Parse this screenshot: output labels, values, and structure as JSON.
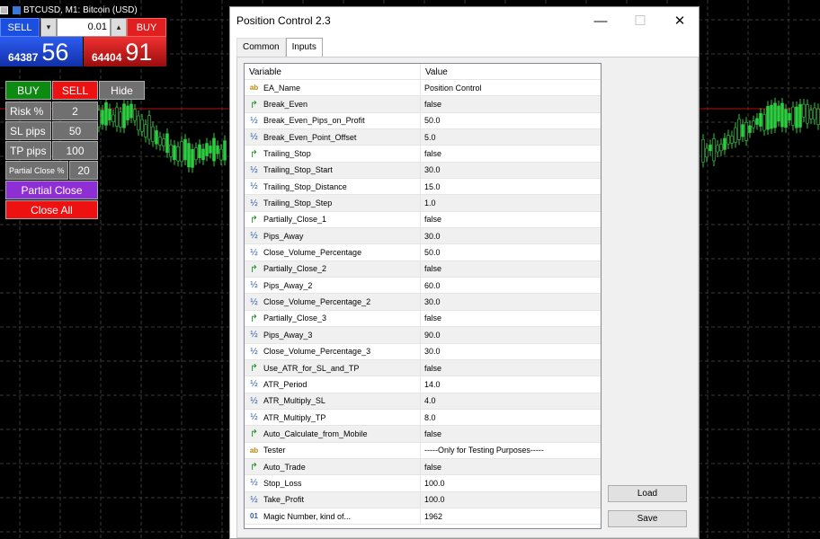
{
  "chart_header": {
    "title": "BTCUSD, M1:  Bitcoin (USD)"
  },
  "one_click": {
    "sell_label": "SELL",
    "buy_label": "BUY",
    "volume": "0.01",
    "down_arrow": "▾",
    "up_arrow": "▴",
    "bid_small": "64387",
    "bid_big": "56",
    "ask_small": "64404",
    "ask_big": "91"
  },
  "panel": {
    "buy": "BUY",
    "sell": "SELL",
    "hide": "Hide",
    "risk_label": "Risk %",
    "risk_value": "2",
    "sl_label": "SL pips",
    "sl_value": "50",
    "tp_label": "TP pips",
    "tp_value": "100",
    "partial_label": "Partial Close %",
    "partial_value": "20",
    "partial_close": "Partial Close",
    "close_all": "Close All"
  },
  "dialog": {
    "title": "Position Control 2.3",
    "minimize": "—",
    "maximize": "☐",
    "close": "✕",
    "tabs": [
      {
        "label": "Common"
      },
      {
        "label": "Inputs"
      }
    ],
    "columns": {
      "variable": "Variable",
      "value": "Value"
    },
    "rows": [
      {
        "icon": "ab",
        "name": "EA_Name",
        "value": "Position Control"
      },
      {
        "icon": "bool",
        "name": "Break_Even",
        "value": "false"
      },
      {
        "icon": "half",
        "name": "Break_Even_Pips_on_Profit",
        "value": "50.0"
      },
      {
        "icon": "half",
        "name": "Break_Even_Point_Offset",
        "value": "5.0"
      },
      {
        "icon": "bool",
        "name": "Trailing_Stop",
        "value": "false"
      },
      {
        "icon": "half",
        "name": "Trailing_Stop_Start",
        "value": "30.0"
      },
      {
        "icon": "half",
        "name": "Trailing_Stop_Distance",
        "value": "15.0"
      },
      {
        "icon": "half",
        "name": "Trailing_Stop_Step",
        "value": "1.0"
      },
      {
        "icon": "bool",
        "name": "Partially_Close_1",
        "value": "false"
      },
      {
        "icon": "half",
        "name": "Pips_Away",
        "value": "30.0"
      },
      {
        "icon": "half",
        "name": "Close_Volume_Percentage",
        "value": "50.0"
      },
      {
        "icon": "bool",
        "name": "Partially_Close_2",
        "value": "false"
      },
      {
        "icon": "half",
        "name": "Pips_Away_2",
        "value": "60.0"
      },
      {
        "icon": "half",
        "name": "Close_Volume_Percentage_2",
        "value": "30.0"
      },
      {
        "icon": "bool",
        "name": "Partially_Close_3",
        "value": "false"
      },
      {
        "icon": "half",
        "name": "Pips_Away_3",
        "value": "90.0"
      },
      {
        "icon": "half",
        "name": "Close_Volume_Percentage_3",
        "value": "30.0"
      },
      {
        "icon": "bool",
        "name": "Use_ATR_for_SL_and_TP",
        "value": "false"
      },
      {
        "icon": "half",
        "name": "ATR_Period",
        "value": "14.0"
      },
      {
        "icon": "half",
        "name": "ATR_Multiply_SL",
        "value": "4.0"
      },
      {
        "icon": "half",
        "name": "ATR_Multiply_TP",
        "value": "8.0"
      },
      {
        "icon": "bool",
        "name": "Auto_Calculate_from_Mobile",
        "value": "false"
      },
      {
        "icon": "ab",
        "name": "Tester",
        "value": "-----Only for Testing Purposes-----"
      },
      {
        "icon": "bool",
        "name": "Auto_Trade",
        "value": "false"
      },
      {
        "icon": "half",
        "name": "Stop_Loss",
        "value": "100.0"
      },
      {
        "icon": "half",
        "name": "Take_Profit",
        "value": "100.0"
      },
      {
        "icon": "num",
        "name": "Magic Number, kind of...",
        "value": "1962"
      }
    ],
    "load": "Load",
    "save": "Save"
  }
}
